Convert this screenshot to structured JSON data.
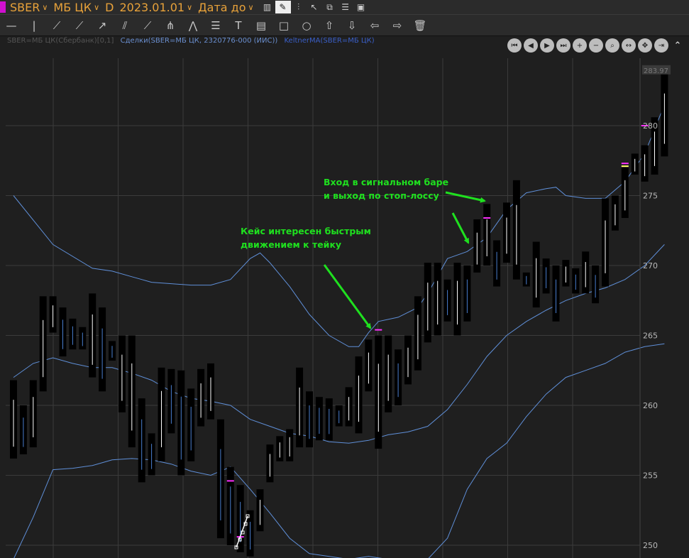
{
  "toolbar": {
    "ticker": "SBER",
    "board": "МБ ЦК",
    "timeframe": "D",
    "date": "2023.01.01",
    "date_mode": "Дата до",
    "swatch_color": "#d010d0"
  },
  "legend": {
    "instrument": "SBER=МБ ЦК(Сбербанк)[0,1]",
    "deals": "Сделки(SBER=МБ ЦК, 2320776-000 (ИИС))",
    "indicator": "KeltnerMA(SBER=МБ ЦК)"
  },
  "chart_data": {
    "type": "bar",
    "ylim": [
      249.2,
      282.0
    ],
    "yticks": [
      250,
      255,
      260,
      265,
      270,
      275,
      280
    ],
    "last_price_label": "283.97",
    "bars": [
      [
        261.8,
        256.2
      ],
      [
        260.0,
        256.5
      ],
      [
        261.8,
        257.0
      ],
      [
        267.8,
        261.0
      ],
      [
        267.8,
        265.2
      ],
      [
        267.0,
        263.5
      ],
      [
        266.2,
        264.0
      ],
      [
        265.6,
        264.0
      ],
      [
        268.0,
        262.0
      ],
      [
        267.0,
        261.0
      ],
      [
        264.6,
        263.2
      ],
      [
        265.0,
        259.5
      ],
      [
        265.0,
        257.0
      ],
      [
        260.5,
        254.5
      ],
      [
        258.0,
        255.0
      ],
      [
        262.7,
        256.0
      ],
      [
        262.6,
        258.0
      ],
      [
        262.5,
        255.0
      ],
      [
        261.2,
        256.0
      ],
      [
        262.6,
        258.5
      ],
      [
        263.0,
        259.0
      ],
      [
        259.0,
        250.5
      ],
      [
        255.6,
        250.0
      ],
      [
        254.3,
        249.5
      ],
      [
        252.5,
        249.2
      ],
      [
        254.0,
        251.0
      ],
      [
        257.2,
        254.5
      ],
      [
        257.8,
        256.0
      ],
      [
        258.3,
        256.0
      ],
      [
        262.7,
        257.0
      ],
      [
        261.0,
        257.0
      ],
      [
        260.6,
        257.5
      ],
      [
        260.5,
        257.5
      ],
      [
        260.0,
        258.5
      ],
      [
        261.3,
        258.5
      ],
      [
        263.5,
        258.0
      ],
      [
        264.7,
        261.0
      ],
      [
        265.0,
        256.9
      ],
      [
        265.0,
        259.5
      ],
      [
        264.0,
        260.0
      ],
      [
        265.0,
        261.5
      ],
      [
        267.8,
        262.5
      ],
      [
        270.2,
        264.5
      ],
      [
        270.2,
        265.0
      ],
      [
        269.0,
        266.0
      ],
      [
        270.2,
        265.0
      ],
      [
        270.0,
        266.0
      ],
      [
        273.3,
        269.5
      ],
      [
        274.4,
        270.0
      ],
      [
        271.8,
        268.5
      ],
      [
        274.5,
        270.2
      ],
      [
        276.1,
        269.0
      ],
      [
        269.5,
        268.5
      ],
      [
        271.7,
        267.0
      ],
      [
        270.5,
        268.0
      ],
      [
        270.0,
        266.0
      ],
      [
        270.4,
        268.5
      ],
      [
        269.8,
        268.0
      ],
      [
        271.0,
        268.0
      ],
      [
        270.0,
        267.3
      ],
      [
        274.8,
        268.5
      ],
      [
        275.0,
        272.5
      ],
      [
        277.0,
        273.4
      ],
      [
        278.0,
        276.5
      ],
      [
        278.6,
        276.0
      ],
      [
        280.6,
        276.5
      ],
      [
        283.8,
        277.8
      ]
    ],
    "band_upper": [
      [
        0,
        275.0
      ],
      [
        4,
        271.5
      ],
      [
        8,
        269.8
      ],
      [
        10,
        269.6
      ],
      [
        12,
        269.2
      ],
      [
        13,
        269.0
      ],
      [
        14,
        268.8
      ],
      [
        16,
        268.7
      ],
      [
        18,
        268.6
      ],
      [
        20,
        268.6
      ],
      [
        22,
        269.0
      ],
      [
        24,
        270.5
      ],
      [
        25,
        270.9
      ],
      [
        26,
        270.2
      ],
      [
        28,
        268.5
      ],
      [
        30,
        266.5
      ],
      [
        32,
        265.0
      ],
      [
        34,
        264.2
      ],
      [
        35,
        264.2
      ],
      [
        36,
        265.2
      ],
      [
        37,
        266.0
      ],
      [
        39,
        266.3
      ],
      [
        41,
        267.0
      ],
      [
        42,
        268.0
      ],
      [
        44,
        270.5
      ],
      [
        46,
        271.0
      ],
      [
        48,
        272.0
      ],
      [
        50,
        274.0
      ],
      [
        52,
        275.2
      ],
      [
        54,
        275.5
      ],
      [
        55,
        275.6
      ],
      [
        56,
        275.0
      ],
      [
        58,
        274.8
      ],
      [
        60,
        274.8
      ],
      [
        62,
        276.0
      ],
      [
        64,
        278.0
      ],
      [
        66,
        281.5
      ]
    ],
    "band_middle": [
      [
        0,
        262.0
      ],
      [
        2,
        263.0
      ],
      [
        4,
        263.4
      ],
      [
        6,
        263.0
      ],
      [
        8,
        262.7
      ],
      [
        10,
        262.7
      ],
      [
        12,
        262.3
      ],
      [
        14,
        261.8
      ],
      [
        16,
        261.0
      ],
      [
        18,
        260.5
      ],
      [
        20,
        260.3
      ],
      [
        22,
        260.0
      ],
      [
        24,
        259.0
      ],
      [
        26,
        258.5
      ],
      [
        28,
        258.0
      ],
      [
        30,
        257.8
      ],
      [
        32,
        257.4
      ],
      [
        34,
        257.3
      ],
      [
        36,
        257.5
      ],
      [
        38,
        257.9
      ],
      [
        40,
        258.1
      ],
      [
        42,
        258.5
      ],
      [
        44,
        259.7
      ],
      [
        46,
        261.5
      ],
      [
        48,
        263.5
      ],
      [
        50,
        265.0
      ],
      [
        52,
        266.0
      ],
      [
        54,
        266.8
      ],
      [
        56,
        267.5
      ],
      [
        58,
        268.0
      ],
      [
        60,
        268.4
      ],
      [
        62,
        269.0
      ],
      [
        64,
        270.0
      ],
      [
        66,
        271.5
      ]
    ],
    "band_lower": [
      [
        0,
        249.0
      ],
      [
        2,
        252.0
      ],
      [
        4,
        255.4
      ],
      [
        6,
        255.5
      ],
      [
        8,
        255.7
      ],
      [
        10,
        256.1
      ],
      [
        12,
        256.2
      ],
      [
        14,
        256.1
      ],
      [
        16,
        255.8
      ],
      [
        18,
        255.3
      ],
      [
        20,
        255.0
      ],
      [
        22,
        255.6
      ],
      [
        24,
        254.0
      ],
      [
        26,
        252.3
      ],
      [
        28,
        250.5
      ],
      [
        30,
        249.4
      ],
      [
        32,
        249.2
      ],
      [
        34,
        249.0
      ],
      [
        36,
        249.2
      ],
      [
        38,
        249.0
      ],
      [
        40,
        249.0
      ],
      [
        42,
        249.0
      ],
      [
        44,
        250.5
      ],
      [
        46,
        254.0
      ],
      [
        48,
        256.2
      ],
      [
        50,
        257.3
      ],
      [
        52,
        259.2
      ],
      [
        54,
        260.8
      ],
      [
        56,
        262.0
      ],
      [
        58,
        262.5
      ],
      [
        60,
        263.0
      ],
      [
        62,
        263.8
      ],
      [
        64,
        264.2
      ],
      [
        66,
        264.4
      ]
    ],
    "deal_markers": [
      {
        "bar": 22,
        "price": 254.6,
        "color": "#ff2fff"
      },
      {
        "bar": 23,
        "price": 250.6,
        "color": "#ff2fff"
      },
      {
        "bar": 37,
        "price": 265.4,
        "color": "#ff2fff"
      },
      {
        "bar": 48,
        "price": 273.4,
        "color": "#ff2fff"
      },
      {
        "bar": 62,
        "price": 277.1,
        "color": "#ffff66"
      },
      {
        "bar": 62,
        "price": 277.3,
        "color": "#ff2fff"
      },
      {
        "bar": 64,
        "price": 280.0,
        "color": "#ff2fff"
      }
    ],
    "annotations": [
      {
        "lines": [
          "Вход в сигнальном баре",
          "и выход по стоп-лоссу"
        ],
        "color": "#1fe01f"
      },
      {
        "lines": [
          "Кейс интересен быстрым",
          "движением к тейку"
        ],
        "color": "#1fe01f"
      }
    ],
    "colors": {
      "background": "#1f1f1f",
      "grid": "#3b3b3b",
      "bar_fill": "#000000",
      "bar_wick": "#ffffff",
      "bar_wick_down": "#4a7fd0",
      "band": "#5f8fd8",
      "annotation": "#1fe01f",
      "axis_text": "#b8b8b8"
    }
  }
}
